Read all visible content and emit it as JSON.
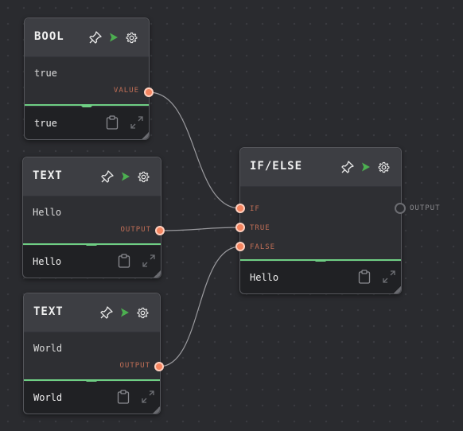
{
  "nodes": {
    "bool": {
      "title": "BOOL",
      "body": "true",
      "output_label": "VALUE",
      "footer": "true"
    },
    "text1": {
      "title": "TEXT",
      "body": "Hello",
      "output_label": "OUTPUT",
      "footer": "Hello"
    },
    "text2": {
      "title": "TEXT",
      "body": "World",
      "output_label": "OUTPUT",
      "footer": "World"
    },
    "ifelse": {
      "title": "IF/ELSE",
      "inputs": [
        "IF",
        "TRUE",
        "FALSE"
      ],
      "output_label": "OUTPUT",
      "footer": "Hello"
    }
  },
  "icons": [
    "pin-icon",
    "run-icon",
    "gear-icon",
    "clipboard-icon",
    "expand-icon"
  ],
  "colors": {
    "background": "#2a2b2f",
    "port": "#f4845f",
    "port_label": "#c06e56",
    "divider": "#6fcf84",
    "run": "#4caf50",
    "wire": "#9a9a9e"
  }
}
